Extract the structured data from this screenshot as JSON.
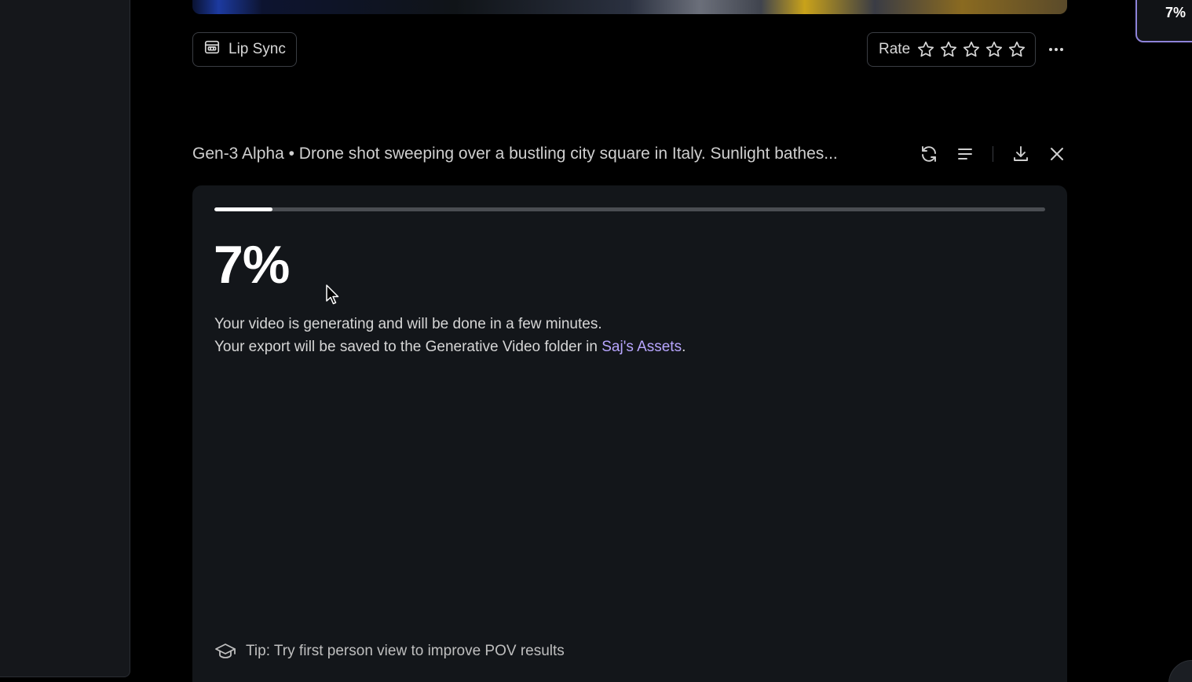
{
  "toolbar": {
    "lip_sync_label": "Lip Sync",
    "rate_label": "Rate",
    "rating_stars": 5,
    "rating_value": 0
  },
  "mini_progress": {
    "percent_label": "7%"
  },
  "generation": {
    "title": "Gen-3 Alpha • Drone shot sweeping over a bustling city square in Italy. Sunlight bathes...",
    "progress_percent": 7,
    "percent_label": "7%",
    "status_line_1": "Your video is generating and will be done in a few minutes.",
    "status_line_2_prefix": "Your export will be saved to the Generative Video folder in ",
    "assets_link": "Saj's Assets",
    "status_line_2_suffix": ".",
    "tip": "Tip: Try first person view to improve POV results"
  },
  "icons": {
    "lip_sync": "lip-sync-icon",
    "star": "star-outline-icon",
    "more": "more-horizontal-icon",
    "refresh": "refresh-icon",
    "details": "align-left-icon",
    "download": "download-icon",
    "close": "close-icon",
    "tip": "graduation-cap-icon"
  },
  "colors": {
    "accent_purple": "#8e83d9",
    "link": "#b8a6ff",
    "progress_fill": "#ffffff",
    "progress_track": "#4a4d52"
  }
}
